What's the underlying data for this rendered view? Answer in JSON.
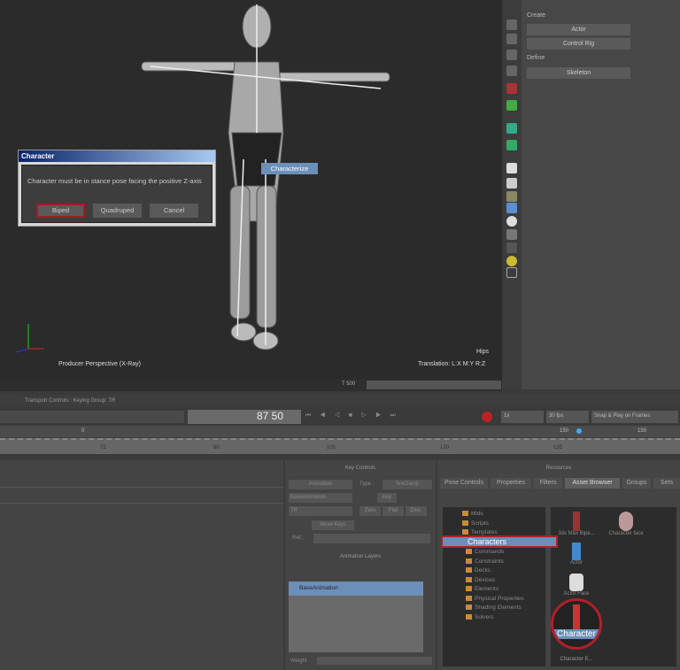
{
  "viewport": {
    "camera_label": "Producer Perspective (X-Ray)",
    "selected": "Hips",
    "translation": "Translation: L:X M:Y R:Z",
    "axis_labels": {
      "x": "X",
      "y": "Y",
      "z": "Z"
    }
  },
  "dialog": {
    "title": "Character",
    "message": "Character must be in stance pose facing the positive Z-axis",
    "buttons": [
      "Biped",
      "Quadruped",
      "Cancel"
    ]
  },
  "context_menu": {
    "item": "Characterize"
  },
  "right_panel": {
    "create_label": "Create",
    "create_buttons": [
      "Actor",
      "Control Rig"
    ],
    "define_label": "Define",
    "define_buttons": [
      "Skeleton"
    ]
  },
  "transport": {
    "title": "Transport Controls : Keying Group: TR",
    "frame": "87",
    "frame_b": "50",
    "speed": "1x",
    "fps": "30 fps",
    "snap": "Snap & Play on Frames",
    "range_start": "0",
    "range_end": "150",
    "range_end2": "150",
    "ruler_ticks": [
      "75",
      "90",
      "105",
      "120",
      "135"
    ],
    "status": "T 500"
  },
  "key_controls": {
    "title": "Key Controls",
    "animation_label": "Animation",
    "type_label": "Type :",
    "type_value": "SmClamp",
    "layer": "BaseAnimation",
    "key_label": "Key",
    "group": "TR",
    "zero": "Zero",
    "flat": "Flat",
    "disc": "Disc.",
    "move_keys": "Move Keys",
    "ref_label": "Ref.:"
  },
  "animation_layers": {
    "title": "Animation Layers",
    "layer": "BaseAnimation",
    "weight_label": "Weight"
  },
  "resources": {
    "title": "Resources",
    "tabs": [
      "Pose Controls",
      "Properties",
      "Filters",
      "Asset Browser",
      "Groups",
      "Sets"
    ],
    "active_tab": "Asset Browser",
    "tree": [
      "Mids",
      "Scripts",
      "Templates",
      "Characters",
      "Commands",
      "Constraints",
      "Decks",
      "Devices",
      "Elements",
      "Physical Properties",
      "Shading Elements",
      "Solvers"
    ],
    "selected_tree": "Characters",
    "assets": [
      "3ds Max Bipe...",
      "Character face",
      "Actor",
      "Actor Face",
      "Character",
      "Character E..."
    ],
    "highlight_color": "#b0202a",
    "selection_color": "#6b8fb8"
  }
}
